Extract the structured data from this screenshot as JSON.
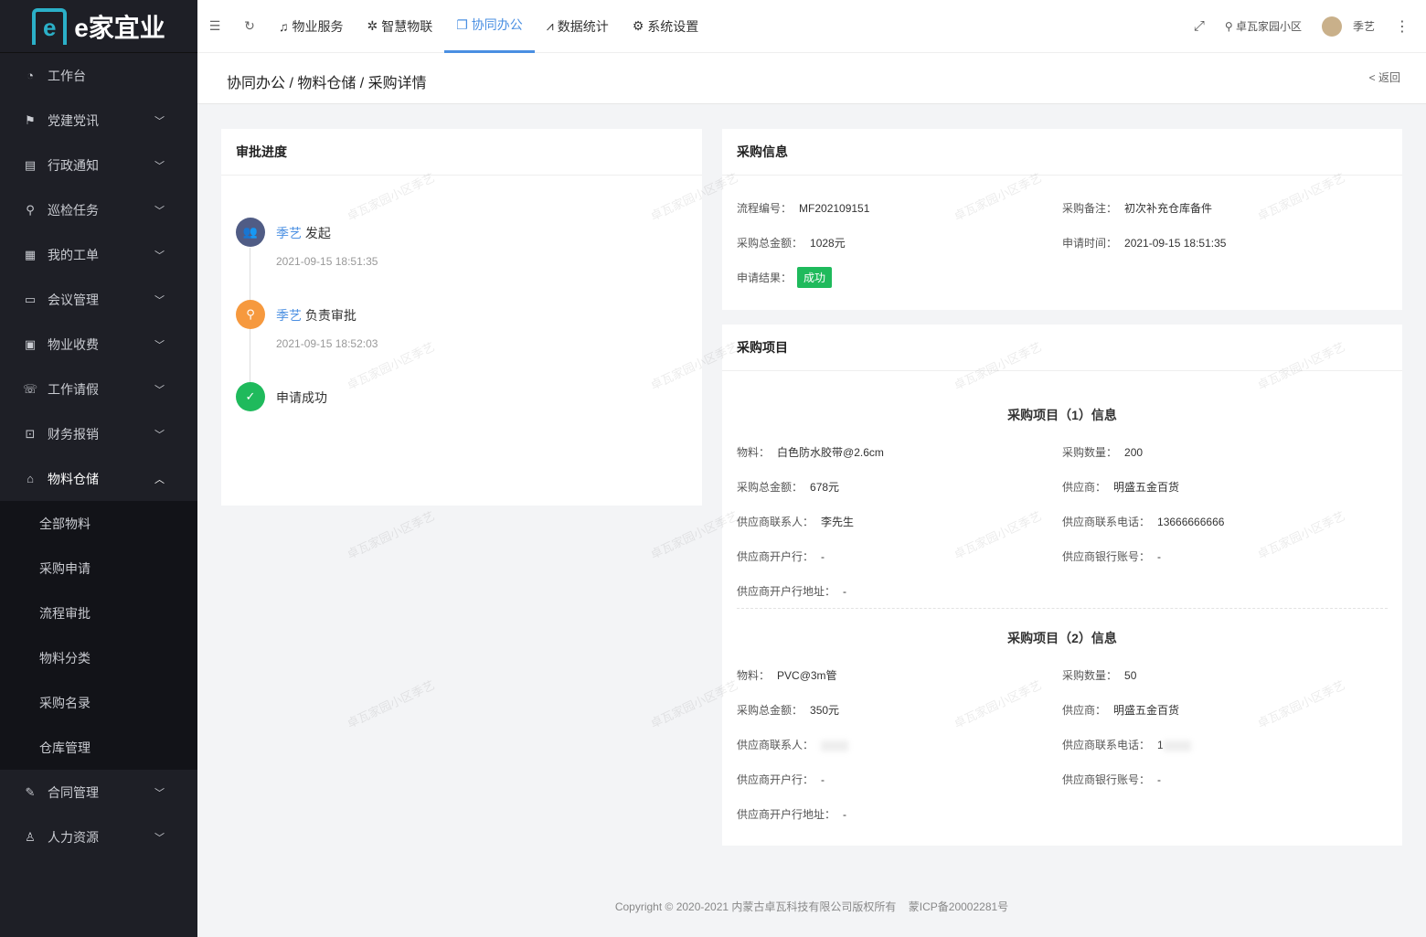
{
  "logo": {
    "text": "e家宜业"
  },
  "sidebar": {
    "items": [
      {
        "label": "工作台",
        "icon": "dashboard-icon"
      },
      {
        "label": "党建党讯",
        "icon": "party-icon"
      },
      {
        "label": "行政通知",
        "icon": "notice-icon"
      },
      {
        "label": "巡检任务",
        "icon": "location-icon"
      },
      {
        "label": "我的工单",
        "icon": "order-icon"
      },
      {
        "label": "会议管理",
        "icon": "meeting-icon"
      },
      {
        "label": "物业收费",
        "icon": "fee-icon"
      },
      {
        "label": "工作请假",
        "icon": "leave-icon"
      },
      {
        "label": "财务报销",
        "icon": "finance-icon"
      },
      {
        "label": "物料仓储",
        "icon": "warehouse-icon"
      }
    ],
    "sub_items": [
      "全部物料",
      "采购申请",
      "流程审批",
      "物料分类",
      "采购名录",
      "仓库管理"
    ],
    "bottom_items": [
      {
        "label": "合同管理"
      },
      {
        "label": "人力资源"
      }
    ]
  },
  "topnav": {
    "items": [
      "物业服务",
      "智慧物联",
      "协同办公",
      "数据统计",
      "系统设置"
    ],
    "active": "协同办公",
    "community": "卓瓦家园小区",
    "user": "季艺"
  },
  "breadcrumb": {
    "path": "协同办公 / 物料仓储 / 采购详情",
    "back": "< 返回"
  },
  "approval": {
    "title": "审批进度",
    "steps": [
      {
        "name": "季艺",
        "action": "发起",
        "time": "2021-09-15 18:51:35"
      },
      {
        "name": "季艺",
        "action": "负责审批",
        "time": "2021-09-15 18:52:03"
      },
      {
        "action": "申请成功"
      }
    ]
  },
  "purchase": {
    "title": "采购信息",
    "flow_no_label": "流程编号：",
    "flow_no": "MF202109151",
    "remark_label": "采购备注：",
    "remark": "初次补充仓库备件",
    "total_label": "采购总金额：",
    "total": "1028元",
    "time_label": "申请时间：",
    "time": "2021-09-15 18:51:35",
    "result_label": "申请结果：",
    "result": "成功"
  },
  "items": {
    "title": "采购项目",
    "labels": {
      "material": "物料：",
      "qty": "采购数量：",
      "amount": "采购总金额：",
      "supplier": "供应商：",
      "contact": "供应商联系人：",
      "phone": "供应商联系电话：",
      "bank": "供应商开户行：",
      "account": "供应商银行账号：",
      "bank_addr": "供应商开户行地址："
    },
    "list": [
      {
        "heading": "采购项目（1）信息",
        "material": "白色防水胶带@2.6cm",
        "qty": "200",
        "amount": "678元",
        "supplier": "明盛五金百货",
        "contact": "李先生",
        "phone": "13666666666",
        "bank": "-",
        "account": "-",
        "bank_addr": "-"
      },
      {
        "heading": "采购项目（2）信息",
        "material": "PVC@3m管",
        "qty": "50",
        "amount": "350元",
        "supplier": "明盛五金百货",
        "contact": "",
        "phone": "1",
        "bank": "-",
        "account": "-",
        "bank_addr": "-"
      }
    ]
  },
  "watermark": "卓瓦家园小区季艺",
  "footer": {
    "copyright": "Copyright © 2020-2021 内蒙古卓瓦科技有限公司版权所有",
    "icp": "蒙ICP备20002281号"
  }
}
